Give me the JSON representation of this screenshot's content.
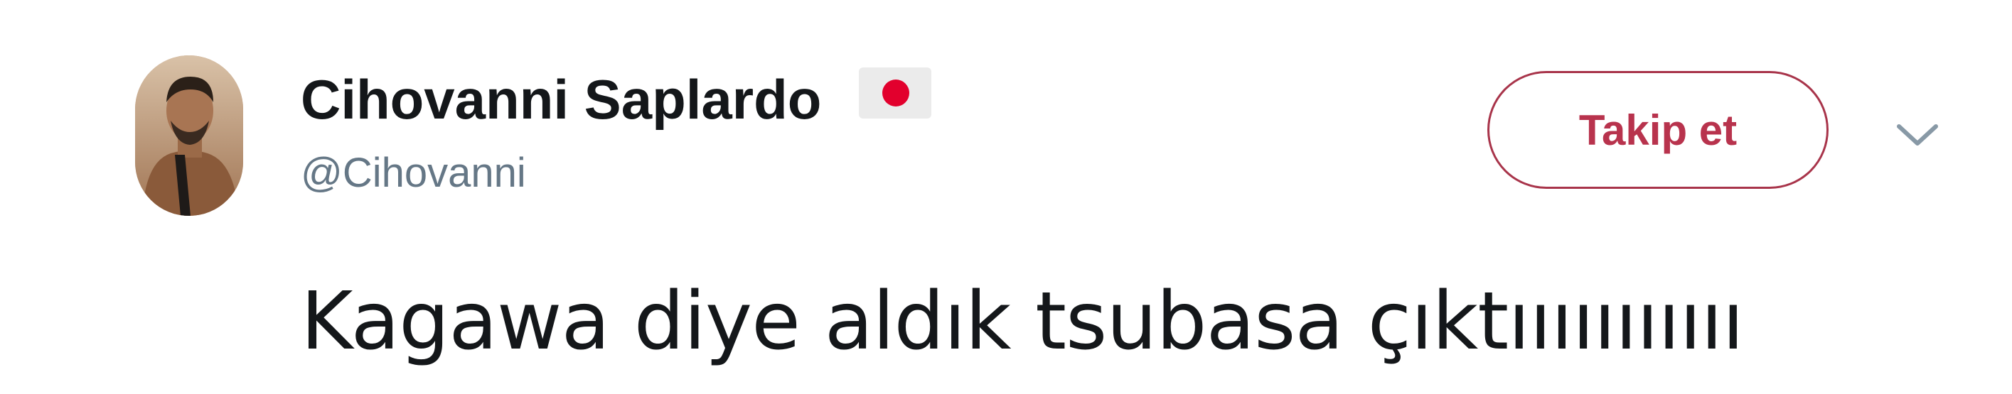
{
  "tweet": {
    "author": {
      "display_name": "Cihovanni Saplardo",
      "handle": "@Cihovanni",
      "flag_icon": "japan-flag-icon"
    },
    "follow_button_label": "Takip et",
    "menu_icon": "chevron-down-icon",
    "text": "Kagawa diye aldık tsubasa çıktııııııııııı"
  },
  "colors": {
    "follow_accent": "#b8334d",
    "name_text": "#14171a",
    "handle_text": "#657786",
    "flag_red": "#e2002d"
  }
}
